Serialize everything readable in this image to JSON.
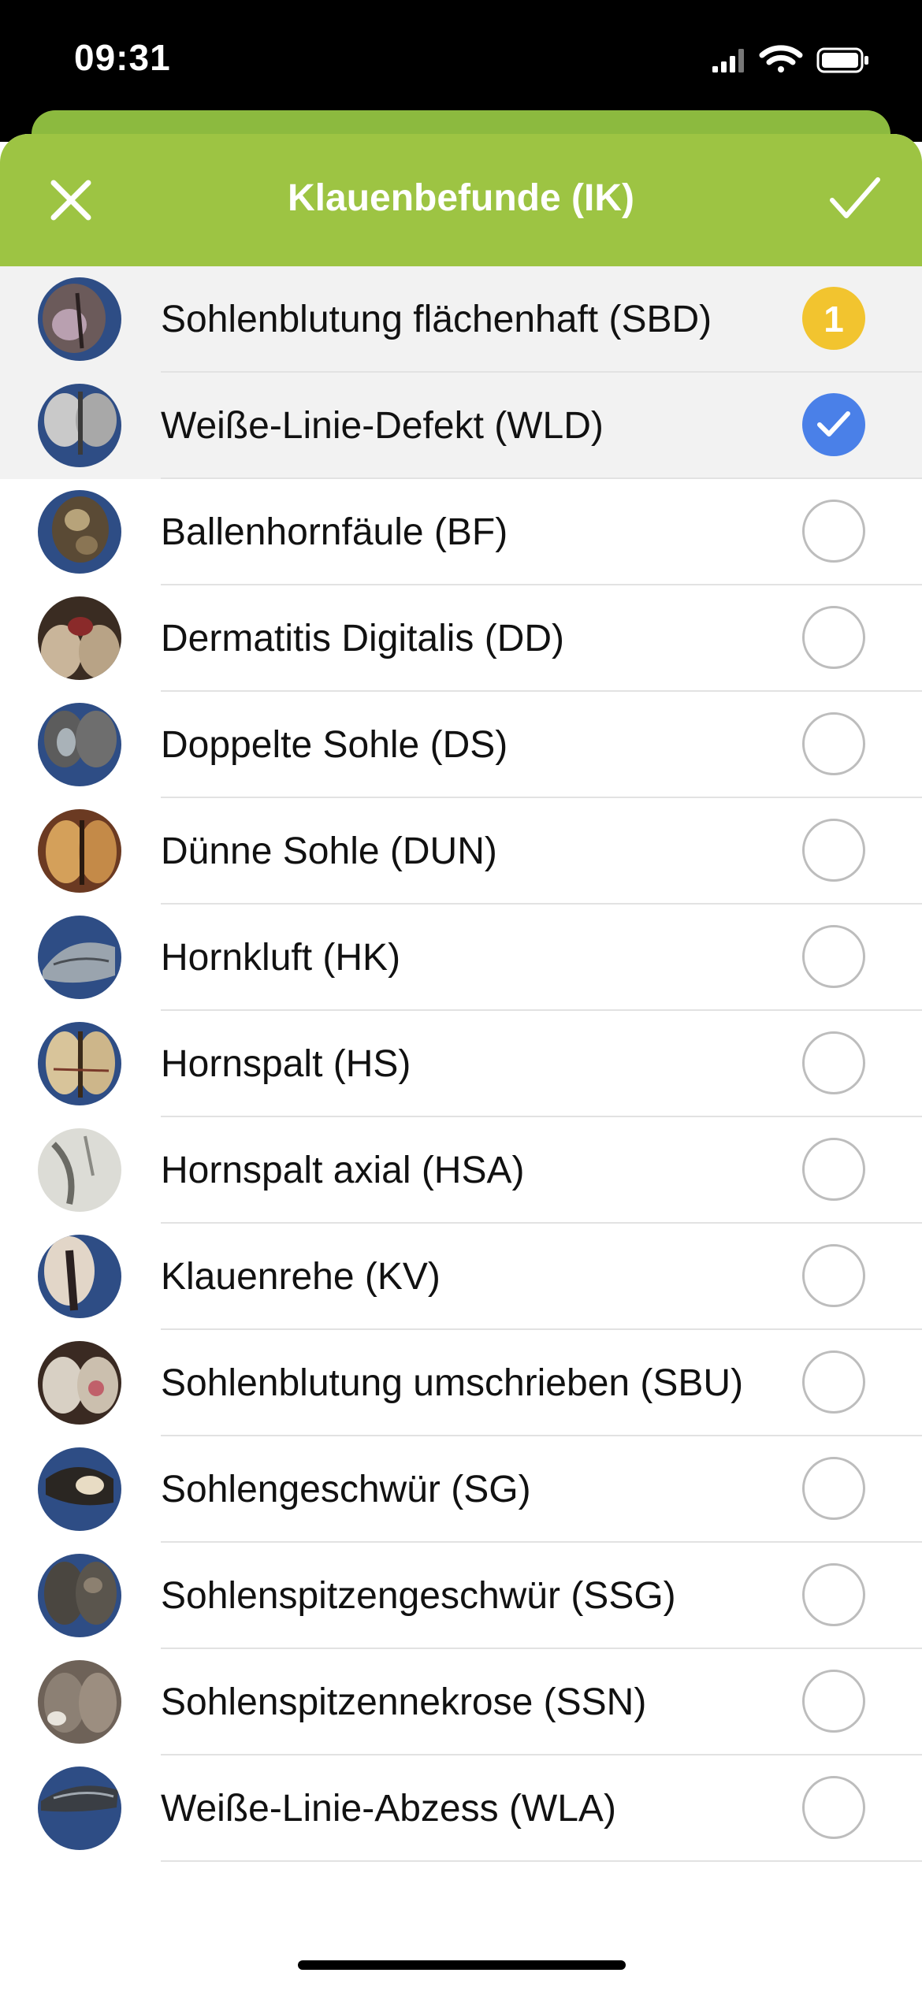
{
  "status_bar": {
    "time": "09:31"
  },
  "nav": {
    "title": "Klauenbefunde (IK)",
    "bar_color": "#9dc443",
    "close_icon": "close-icon",
    "confirm_icon": "checkmark-icon"
  },
  "colors": {
    "selected_check": "#4a80e8",
    "counter_badge": "#f2c42f",
    "row_selected_bg": "#f2f2f2"
  },
  "findings": [
    {
      "label": "Sohlenblutung flächenhaft (SBD)",
      "state": "count",
      "count": "1",
      "highlighted": true
    },
    {
      "label": "Weiße-Linie-Defekt (WLD)",
      "state": "checked",
      "highlighted": true
    },
    {
      "label": "Ballenhornfäule (BF)",
      "state": "unchecked",
      "highlighted": false
    },
    {
      "label": "Dermatitis Digitalis (DD)",
      "state": "unchecked",
      "highlighted": false
    },
    {
      "label": "Doppelte Sohle (DS)",
      "state": "unchecked",
      "highlighted": false
    },
    {
      "label": "Dünne Sohle (DUN)",
      "state": "unchecked",
      "highlighted": false
    },
    {
      "label": "Hornkluft (HK)",
      "state": "unchecked",
      "highlighted": false
    },
    {
      "label": "Hornspalt (HS)",
      "state": "unchecked",
      "highlighted": false
    },
    {
      "label": "Hornspalt axial (HSA)",
      "state": "unchecked",
      "highlighted": false
    },
    {
      "label": "Klauenrehe (KV)",
      "state": "unchecked",
      "highlighted": false
    },
    {
      "label": "Sohlenblutung umschrieben (SBU)",
      "state": "unchecked",
      "highlighted": false
    },
    {
      "label": "Sohlengeschwür (SG)",
      "state": "unchecked",
      "highlighted": false
    },
    {
      "label": "Sohlenspitzengeschwür (SSG)",
      "state": "unchecked",
      "highlighted": false
    },
    {
      "label": "Sohlenspitzennekrose (SSN)",
      "state": "unchecked",
      "highlighted": false
    },
    {
      "label": "Weiße-Linie-Abzess (WLA)",
      "state": "unchecked",
      "highlighted": false
    }
  ]
}
